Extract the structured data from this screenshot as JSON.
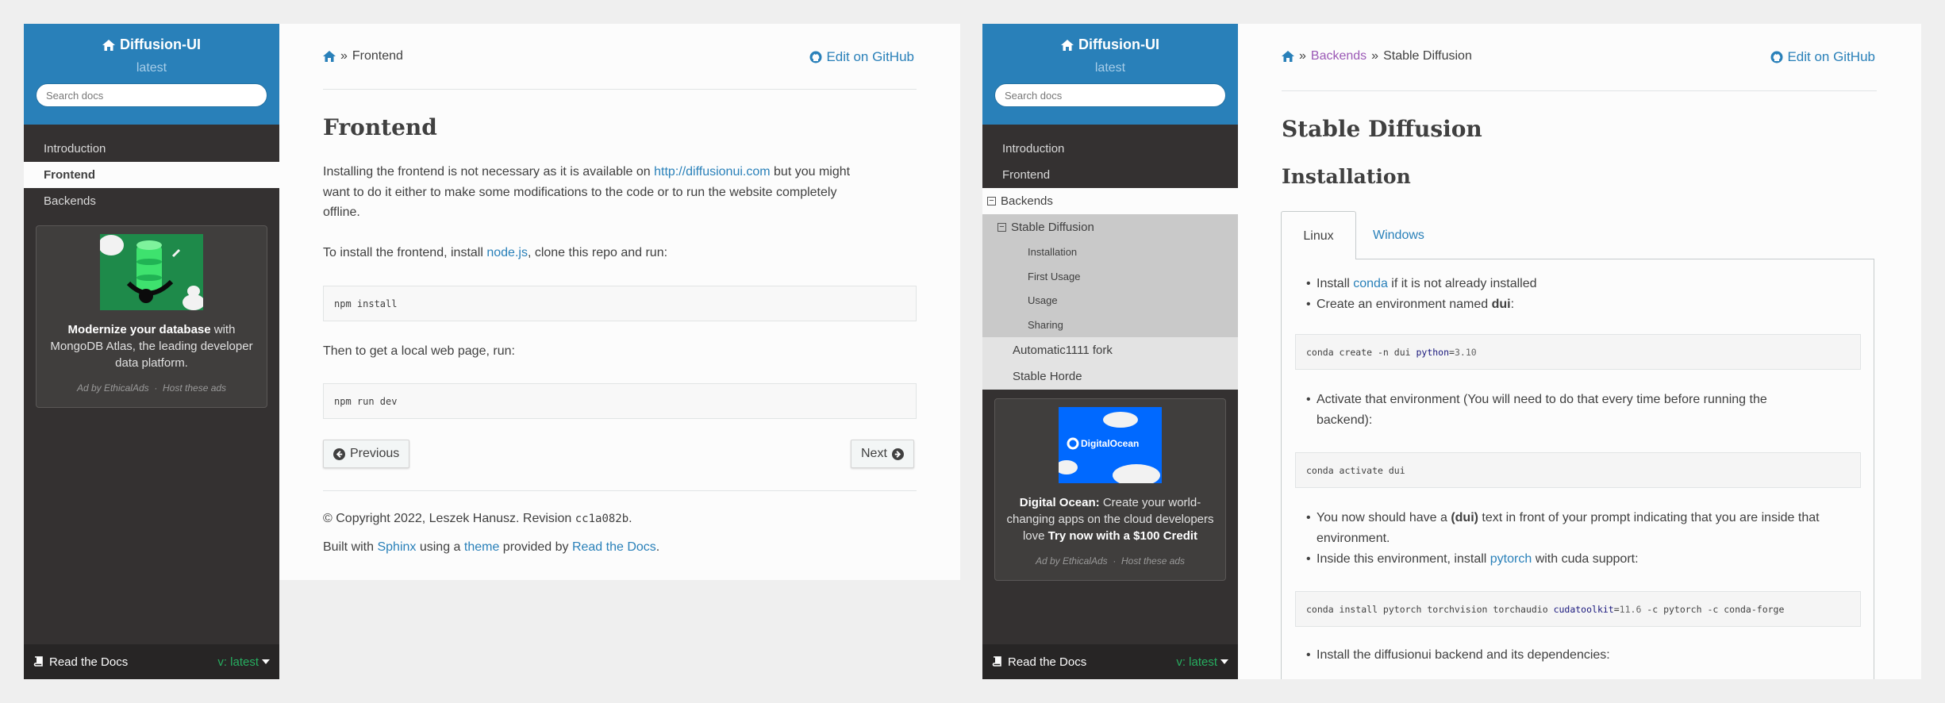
{
  "left": {
    "sidebar": {
      "project": "Diffusion-UI",
      "version": "latest",
      "search_placeholder": "Search docs",
      "items": [
        {
          "label": "Introduction"
        },
        {
          "label": "Frontend"
        },
        {
          "label": "Backends"
        }
      ],
      "ad": {
        "bold": "Modernize your database",
        "text": " with MongoDB Atlas, the leading developer data platform.",
        "by": "Ad by EthicalAds",
        "host": "Host these ads"
      },
      "rtd": "Read the Docs",
      "rtd_version": "v: latest"
    },
    "breadcrumb": {
      "sep": "»",
      "current": "Frontend"
    },
    "edit": "Edit on GitHub",
    "title": "Frontend",
    "p1_a": "Installing the frontend is not necessary as it is available on ",
    "p1_link": "http://diffusionui.com",
    "p1_b": " but you might",
    "p1_c": "want to do it either to make some modifications to the code or to run the website completely",
    "p1_d": "offline.",
    "p2_a": "To install the frontend, install ",
    "p2_link": "node.js",
    "p2_b": ", clone this repo and run:",
    "code1": "npm install",
    "p3": "Then to get a local web page, run:",
    "code2": "npm run dev",
    "prev": "Previous",
    "next": "Next",
    "copyright_a": "© Copyright 2022, Leszek Hanusz. Revision ",
    "revision": "cc1a082b",
    "copyright_b": ".",
    "built_a": "Built with ",
    "sphinx": "Sphinx",
    "built_b": " using a ",
    "theme": "theme",
    "built_c": " provided by ",
    "rtd": "Read the Docs",
    "built_d": "."
  },
  "right": {
    "sidebar": {
      "project": "Diffusion-UI",
      "version": "latest",
      "search_placeholder": "Search docs",
      "items": {
        "introduction": "Introduction",
        "frontend": "Frontend",
        "backends": "Backends",
        "stable_diffusion": "Stable Diffusion",
        "installation": "Installation",
        "first_usage": "First Usage",
        "usage": "Usage",
        "sharing": "Sharing",
        "automatic": "Automatic1111 fork",
        "horde": "Stable Horde"
      },
      "ad": {
        "logo_text": "DigitalOcean",
        "bold": "Digital Ocean:",
        "text": " Create your world-changing apps on the cloud developers love ",
        "bold2": "Try now with a $100 Credit",
        "by": "Ad by EthicalAds",
        "host": "Host these ads"
      },
      "rtd": "Read the Docs",
      "rtd_version": "v: latest"
    },
    "breadcrumb": {
      "sep": "»",
      "parent": "Backends",
      "current": "Stable Diffusion"
    },
    "edit": "Edit on GitHub",
    "title": "Stable Diffusion",
    "subtitle": "Installation",
    "tabs": [
      "Linux",
      "Windows"
    ],
    "b1_a": "Install ",
    "b1_link": "conda",
    "b1_b": " if it is not already installed",
    "b2_a": "Create an environment named ",
    "b2_bold": "dui",
    "b2_b": ":",
    "code1_a": "conda create -n dui ",
    "code1_kw": "python",
    "code1_b": "=",
    "code1_num": "3.10",
    "b3_a": "Activate that environment (You will need to do that every time before running the",
    "b3_b": "backend):",
    "code2": "conda activate dui",
    "b4_a": "You now should have a ",
    "b4_bold": "(dui)",
    "b4_b": " text in front of your prompt indicating that you are inside that",
    "b4_c": "environment.",
    "b5_a": "Inside this environment, install ",
    "b5_link": "pytorch",
    "b5_b": " with cuda support:",
    "code3_a": "conda install pytorch torchvision torchaudio ",
    "code3_kw": "cudatoolkit",
    "code3_b": "=",
    "code3_num": "11.6",
    "code3_c": " -c pytorch -c conda-forge",
    "b6": "Install the diffusionui backend and its dependencies:"
  }
}
